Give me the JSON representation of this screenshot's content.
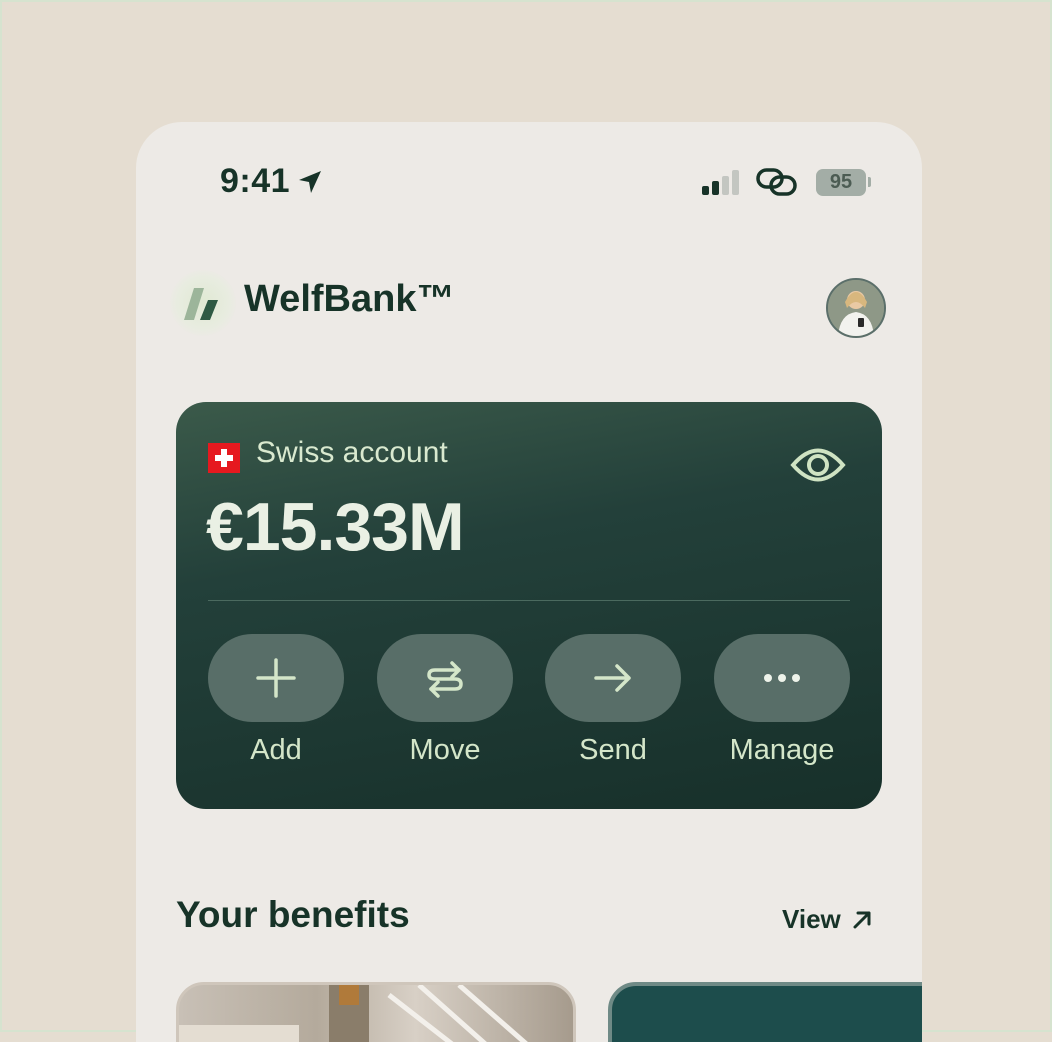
{
  "status_bar": {
    "time": "9:41",
    "battery": "95"
  },
  "header": {
    "brand": "WelfBank™"
  },
  "account": {
    "name": "Swiss account",
    "balance": "€15.33M",
    "actions": [
      {
        "label": "Add",
        "icon": "plus-icon"
      },
      {
        "label": "Move",
        "icon": "transfer-icon"
      },
      {
        "label": "Send",
        "icon": "arrow-right-icon"
      },
      {
        "label": "Manage",
        "icon": "more-dots-icon"
      }
    ]
  },
  "benefits": {
    "title": "Your benefits",
    "view_label": "View"
  },
  "colors": {
    "accent": "#173328",
    "card": "#23403a",
    "pill": "#586e68",
    "label": "#d4e6c9"
  }
}
